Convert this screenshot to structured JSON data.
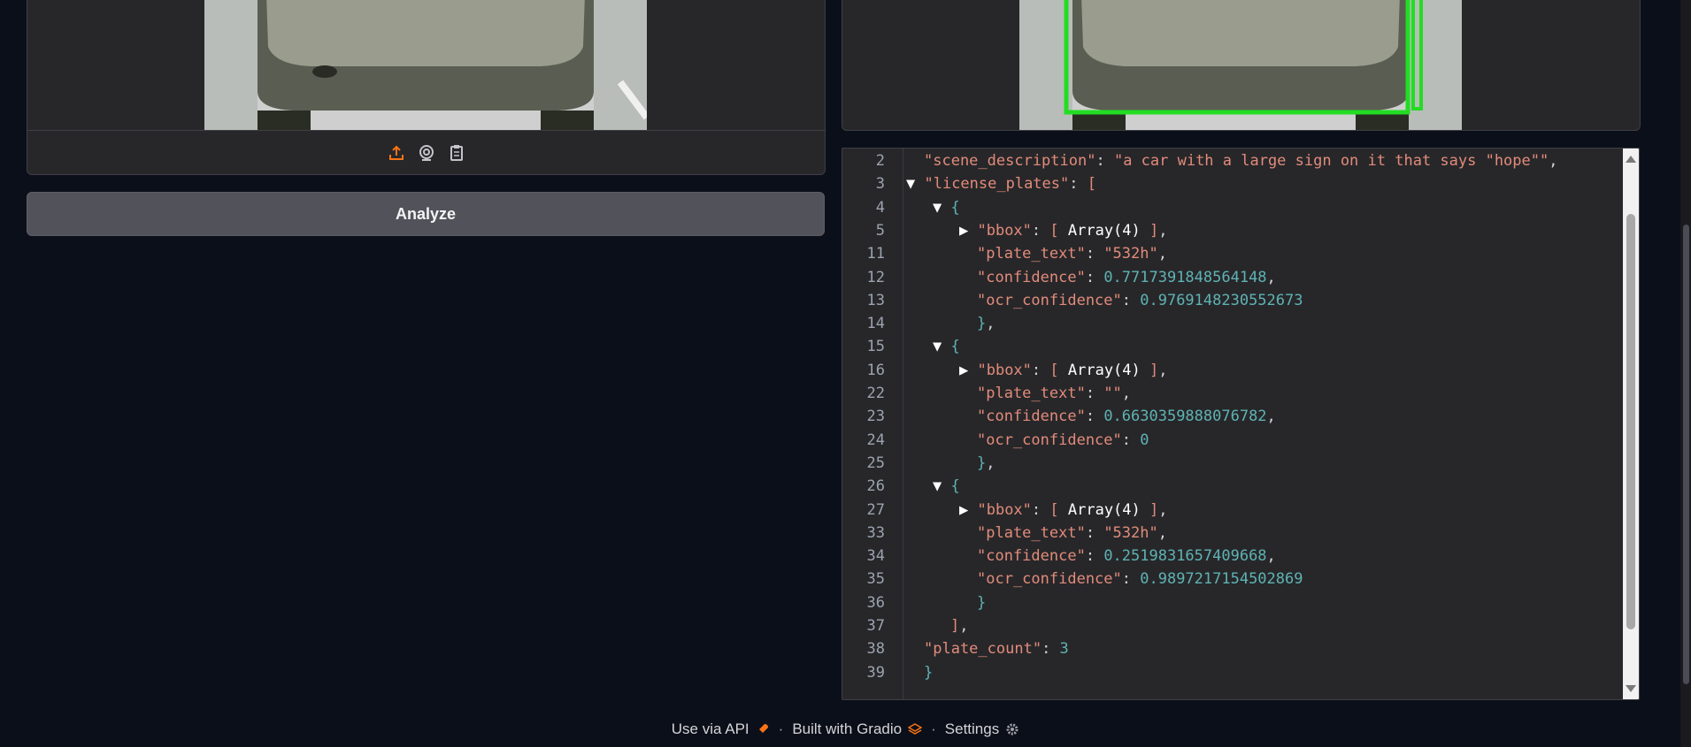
{
  "toolbar": {
    "icons": [
      "upload-icon",
      "webcam-icon",
      "clipboard-icon"
    ]
  },
  "analyze": {
    "label": "Analyze"
  },
  "json_view": {
    "lines": [
      {
        "n": "2",
        "indent": 1,
        "key": "scene_description",
        "value": "a car with a large sign on it that says \"hope\"",
        "vt": "s",
        "tail": ","
      },
      {
        "n": "3",
        "indent": 1,
        "tri": "▼",
        "key": "license_plates",
        "open": "["
      },
      {
        "n": "4",
        "indent": 2,
        "tri": "▼",
        "open": "{"
      },
      {
        "n": "5",
        "indent": 3,
        "tri": "▶",
        "key": "bbox",
        "collapsed": "Array(4)",
        "tail": ","
      },
      {
        "n": "11",
        "indent": 3,
        "key": "plate_text",
        "value": "532h",
        "vt": "s",
        "tail": ","
      },
      {
        "n": "12",
        "indent": 3,
        "key": "confidence",
        "value": "0.7717391848564148",
        "vt": "n",
        "tail": ","
      },
      {
        "n": "13",
        "indent": 3,
        "key": "ocr_confidence",
        "value": "0.9769148230552673",
        "vt": "n"
      },
      {
        "n": "14",
        "indent": 3,
        "close": "}",
        "tail": ","
      },
      {
        "n": "15",
        "indent": 2,
        "tri": "▼",
        "open": "{"
      },
      {
        "n": "16",
        "indent": 3,
        "tri": "▶",
        "key": "bbox",
        "collapsed": "Array(4)",
        "tail": ","
      },
      {
        "n": "22",
        "indent": 3,
        "key": "plate_text",
        "value": "",
        "vt": "s",
        "tail": ","
      },
      {
        "n": "23",
        "indent": 3,
        "key": "confidence",
        "value": "0.6630359888076782",
        "vt": "n",
        "tail": ","
      },
      {
        "n": "24",
        "indent": 3,
        "key": "ocr_confidence",
        "value": "0",
        "vt": "n"
      },
      {
        "n": "25",
        "indent": 3,
        "close": "}",
        "tail": ","
      },
      {
        "n": "26",
        "indent": 2,
        "tri": "▼",
        "open": "{"
      },
      {
        "n": "27",
        "indent": 3,
        "tri": "▶",
        "key": "bbox",
        "collapsed": "Array(4)",
        "tail": ","
      },
      {
        "n": "33",
        "indent": 3,
        "key": "plate_text",
        "value": "532h",
        "vt": "s",
        "tail": ","
      },
      {
        "n": "34",
        "indent": 3,
        "key": "confidence",
        "value": "0.2519831657409668",
        "vt": "n",
        "tail": ","
      },
      {
        "n": "35",
        "indent": 3,
        "key": "ocr_confidence",
        "value": "0.9897217154502869",
        "vt": "n"
      },
      {
        "n": "36",
        "indent": 3,
        "close": "}"
      },
      {
        "n": "37",
        "indent": 2,
        "closeArr": "]",
        "tail": ","
      },
      {
        "n": "38",
        "indent": 1,
        "key": "plate_count",
        "value": "3",
        "vt": "n"
      },
      {
        "n": "39",
        "indent": 1,
        "close": "}"
      }
    ]
  },
  "footer": {
    "api": "Use via API",
    "gradio": "Built with Gradio",
    "settings": "Settings",
    "sep": "·"
  },
  "colors": {
    "accent": "#f97316",
    "box": "#22dd22"
  }
}
